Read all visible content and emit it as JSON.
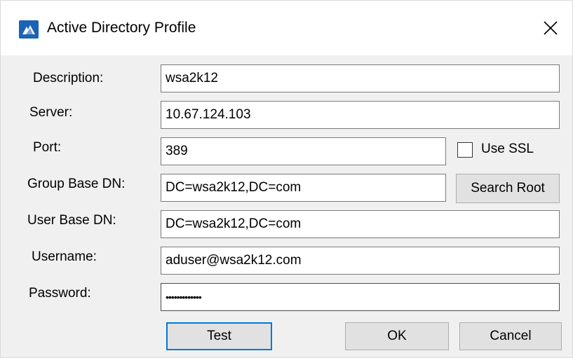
{
  "window": {
    "title": "Active Directory Profile",
    "accent_color": "#1a63b8"
  },
  "form": {
    "description": {
      "label": "Description:",
      "value": "wsa2k12"
    },
    "server": {
      "label": "Server:",
      "value": "10.67.124.103"
    },
    "port": {
      "label": "Port:",
      "value": "389"
    },
    "use_ssl": {
      "label": "Use SSL",
      "checked": false
    },
    "group_base_dn": {
      "label": "Group Base DN:",
      "value": "DC=wsa2k12,DC=com"
    },
    "user_base_dn": {
      "label": "User Base DN:",
      "value": "DC=wsa2k12,DC=com"
    },
    "username": {
      "label": "Username:",
      "value": "aduser@wsa2k12.com"
    },
    "password": {
      "label": "Password:",
      "value": "•••••••••••••"
    }
  },
  "buttons": {
    "search_root": "Search Root",
    "test": "Test",
    "ok": "OK",
    "cancel": "Cancel"
  }
}
